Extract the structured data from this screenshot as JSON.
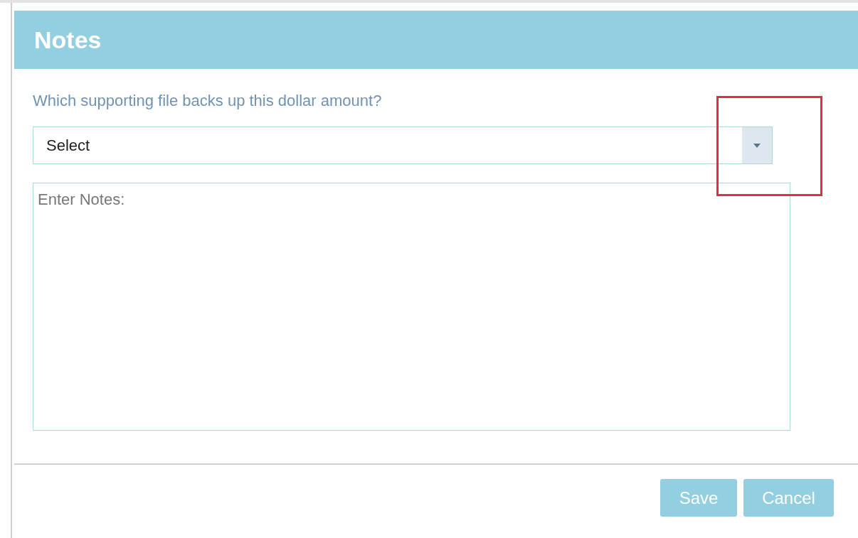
{
  "dialog": {
    "title": "Notes",
    "prompt": "Which supporting file backs up this dollar amount?",
    "file_select": {
      "value": "Select"
    },
    "notes": {
      "placeholder": "Enter Notes:"
    },
    "buttons": [
      "Save",
      "Cancel"
    ]
  }
}
